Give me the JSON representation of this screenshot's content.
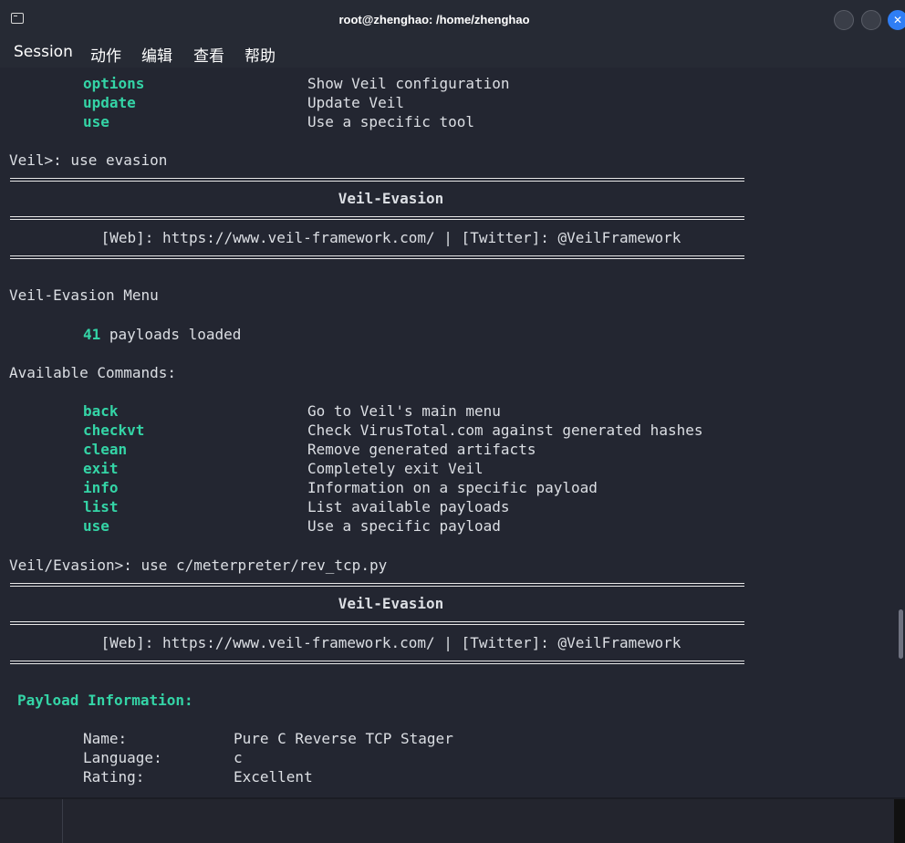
{
  "window": {
    "title": "root@zhenghao: /home/zhenghao",
    "close_glyph": "✕"
  },
  "menu": [
    "Session",
    "动作",
    "编辑",
    "查看",
    "帮助"
  ],
  "top_commands": [
    {
      "cmd": "options",
      "desc": "Show Veil configuration"
    },
    {
      "cmd": "update",
      "desc": "Update Veil"
    },
    {
      "cmd": "use",
      "desc": "Use a specific tool"
    }
  ],
  "prompt1": "Veil>: use evasion",
  "banner": {
    "title": "Veil-Evasion",
    "links": "[Web]: https://www.veil-framework.com/ | [Twitter]: @VeilFramework"
  },
  "evasion_menu_title": "Veil-Evasion Menu",
  "payloads_count": "41",
  "payloads_text": " payloads loaded",
  "available_commands_label": "Available Commands:",
  "evasion_commands": [
    {
      "cmd": "back",
      "desc": "Go to Veil's main menu"
    },
    {
      "cmd": "checkvt",
      "desc": "Check VirusTotal.com against generated hashes"
    },
    {
      "cmd": "clean",
      "desc": "Remove generated artifacts"
    },
    {
      "cmd": "exit",
      "desc": "Completely exit Veil"
    },
    {
      "cmd": "info",
      "desc": "Information on a specific payload"
    },
    {
      "cmd": "list",
      "desc": "List available payloads"
    },
    {
      "cmd": "use",
      "desc": "Use a specific payload"
    }
  ],
  "prompt2": "Veil/Evasion>: use c/meterpreter/rev_tcp.py",
  "payload_info_title": "Payload Information:",
  "payload_info": [
    {
      "label": "Name:",
      "value": "Pure C Reverse TCP Stager"
    },
    {
      "label": "Language:",
      "value": "c"
    },
    {
      "label": "Rating:",
      "value": "Excellent"
    }
  ],
  "colors": {
    "accent": "#34d4a6",
    "background": "#232631",
    "text": "#dcdfe4"
  }
}
